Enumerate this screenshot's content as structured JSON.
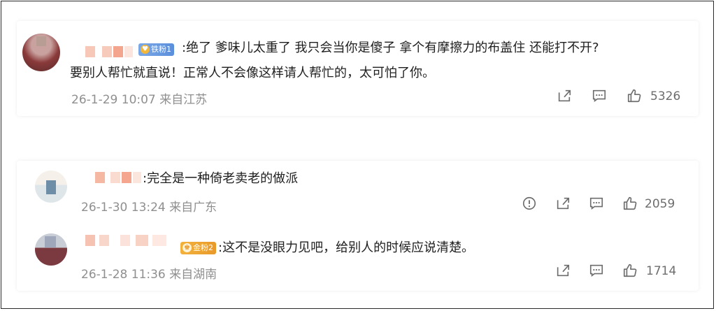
{
  "comments": [
    {
      "badge": "铁粉1",
      "text_line1": ":绝了 爹味儿太重了 我只会当你是傻子  拿个有摩擦力的布盖住 还能打不开?",
      "text_line2": "要别人帮忙就直说！正常人不会像这样请人帮忙的，太可怕了你。",
      "time": "26-1-29 10:07",
      "location": "来自江苏",
      "likes": "5326"
    },
    {
      "text": ":完全是一种倚老卖老的做派",
      "time": "26-1-30 13:24",
      "location": "来自广东",
      "likes": "2059"
    },
    {
      "badge": "金粉2",
      "text": ":这不是没眼力见吧，给别人的时候应说清楚。",
      "time": "26-1-28 11:36",
      "location": "来自湖南",
      "likes": "1714"
    }
  ],
  "icons": {
    "share": "share-icon",
    "comment": "comment-icon",
    "like": "thumbs-up-icon",
    "report": "report-icon"
  }
}
